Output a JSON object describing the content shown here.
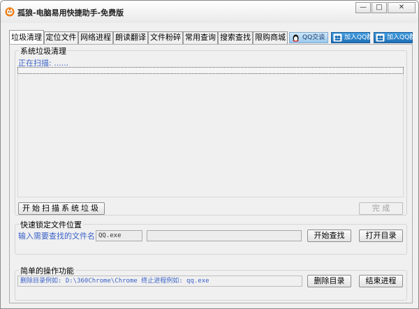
{
  "window": {
    "title": "孤狼-电脑易用快捷助手-免费版",
    "controls": {
      "minimize": "—",
      "maximize": "□",
      "close": "✕"
    }
  },
  "tabs": [
    {
      "label": "垃圾清理",
      "active": true
    },
    {
      "label": "定位文件",
      "active": false
    },
    {
      "label": "网络进程",
      "active": false
    },
    {
      "label": "朗读翻译",
      "active": false
    },
    {
      "label": "文件粉碎",
      "active": false
    },
    {
      "label": "常用查询",
      "active": false
    },
    {
      "label": "搜索查找",
      "active": false
    },
    {
      "label": "限购商城",
      "active": false
    }
  ],
  "links": {
    "qq_chat": "QQ交谈",
    "qq_group_1": "加入QQ群",
    "qq_group_2": "加入QQ群"
  },
  "cleanup": {
    "group_title": "系统垃圾清理",
    "scanning_label": "正在扫描: ......",
    "start_button": "开始扫描系统垃圾",
    "done_button": "完 成"
  },
  "locate": {
    "group_title": "快速锁定文件位置",
    "prompt": "输入需要查找的文件名:",
    "filename_value": "QQ.exe",
    "result_value": "",
    "search_button": "开始查找",
    "open_dir_button": "打开目录"
  },
  "ops": {
    "group_title": "简单的操作功能",
    "command_hint": "删除目录例如: D:\\360Chrome\\Chrome 终止进程例如: qq.exe",
    "delete_dir_button": "删除目录",
    "kill_process_button": "结束进程"
  },
  "colors": {
    "hint_text": "#3b62c8",
    "qq_group_bg": "#1e6fb5",
    "app_icon": "#f07a12"
  }
}
